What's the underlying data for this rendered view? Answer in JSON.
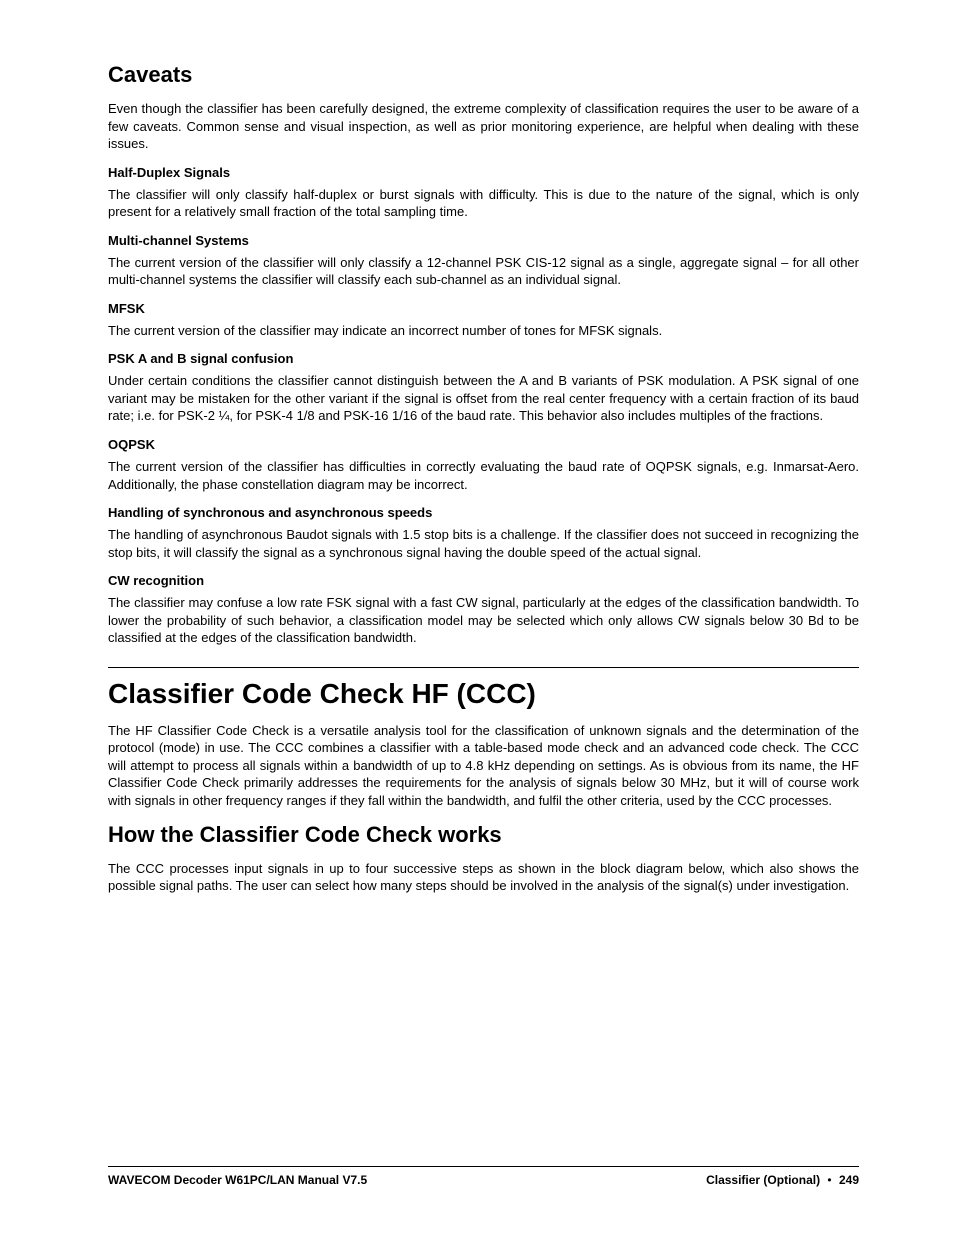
{
  "headings": {
    "caveats": "Caveats",
    "ccc": "Classifier Code Check HF (CCC)",
    "how_works": "How the Classifier Code Check works"
  },
  "caveats_intro": "Even though the classifier has been carefully designed, the extreme complexity of classification requires the user to be aware of a few caveats. Common sense and visual inspection, as well as prior monitoring experience, are helpful when dealing with these issues.",
  "half_duplex": {
    "title": "Half-Duplex Signals",
    "body": "The classifier will only classify half-duplex or burst signals with difficulty. This is due to the nature of the signal, which is only present for a relatively small fraction of the total sampling time."
  },
  "multi_channel": {
    "title": "Multi-channel Systems",
    "body": "The current version of the classifier will only classify a 12-channel PSK CIS-12 signal as a single, aggregate signal – for all other multi-channel systems the classifier will classify each sub-channel as an individual signal."
  },
  "mfsk": {
    "title": "MFSK",
    "body": "The current version of the classifier may indicate an incorrect number of tones for MFSK signals."
  },
  "psk_ab": {
    "title": "PSK A and B signal confusion",
    "body": "Under certain conditions the classifier cannot distinguish between the A and B variants of PSK modulation. A PSK signal of one variant may be mistaken for the other variant if the signal is offset from the real center frequency with a certain fraction of its baud rate; i.e. for PSK-2 ¼, for PSK-4 1/8 and PSK-16 1/16 of the baud rate. This behavior also includes multiples of the fractions."
  },
  "oqpsk": {
    "title": "OQPSK",
    "body": "The current version of the classifier has difficulties in correctly evaluating the baud rate of OQPSK signals, e.g. Inmarsat-Aero. Additionally, the phase constellation diagram may be incorrect."
  },
  "sync_async": {
    "title": "Handling of synchronous and asynchronous speeds",
    "body": "The handling of asynchronous Baudot signals with 1.5 stop bits is a challenge. If the classifier does not succeed in recognizing the stop bits, it will classify the signal as a synchronous signal having the double speed of the actual signal."
  },
  "cw": {
    "title": "CW recognition",
    "body": "The classifier may confuse a low rate FSK signal with a fast CW signal, particularly at the edges of the classification bandwidth. To lower the probability of such behavior, a classification model may be selected which only allows CW signals below 30 Bd to be classified at the edges of the classification bandwidth."
  },
  "ccc_intro": "The HF Classifier Code Check is a versatile analysis tool for the classification of unknown signals and the determination of the protocol (mode) in use. The CCC combines a classifier with a table-based mode check and an advanced code check. The CCC will attempt to process all signals within a bandwidth of up to 4.8 kHz depending on settings. As is obvious from its name, the HF Classifier Code Check primarily addresses the requirements for the analysis of signals below 30 MHz, but it will of course work with signals in other frequency ranges if they fall within the bandwidth, and fulfil the other criteria, used by the CCC processes.",
  "how_works_body": "The CCC processes input signals in up to four successive steps as shown in the block diagram below, which also shows the possible signal paths. The user can select how many steps should be involved in the analysis of the signal(s) under investigation.",
  "footer": {
    "left": "WAVECOM Decoder W61PC/LAN Manual V7.5",
    "right_section": "Classifier (Optional)",
    "page": "249"
  }
}
